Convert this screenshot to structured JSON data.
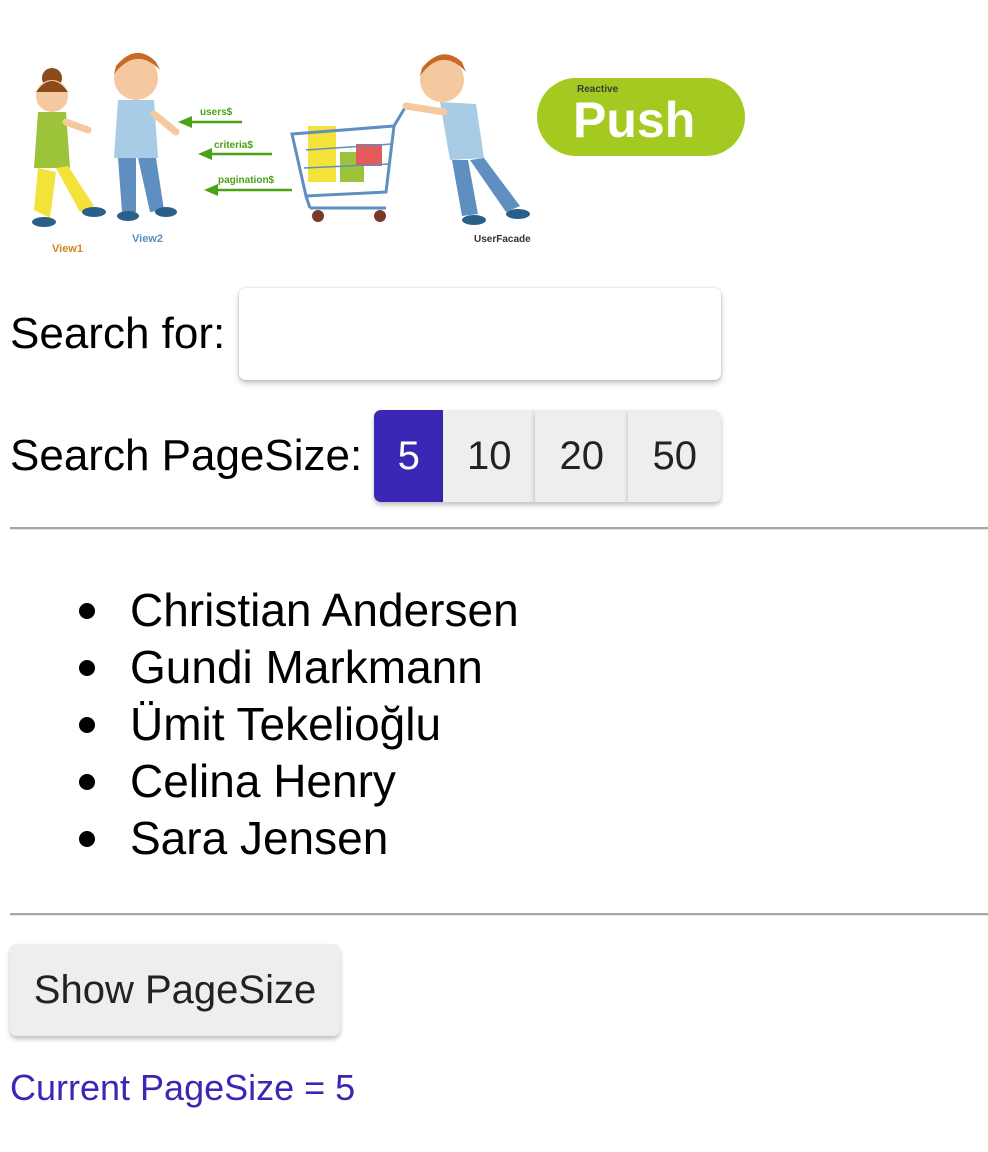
{
  "banner": {
    "arrows": {
      "users": "users$",
      "criteria": "criteria$",
      "pagination": "pagination$"
    },
    "characters": {
      "view1": "View1",
      "view2": "View2",
      "facade": "UserFacade"
    },
    "logo": {
      "small": "Reactive",
      "big": "Push",
      "color": "#a4c920"
    }
  },
  "search": {
    "label": "Search for:",
    "value": "",
    "placeholder": ""
  },
  "pagesize": {
    "label": "Search PageSize:",
    "options": [
      "5",
      "10",
      "20",
      "50"
    ],
    "selected": "5",
    "accent": "#3a27b4"
  },
  "users": [
    "Christian Andersen",
    "Gundi Markmann",
    "Ümit Tekelioğlu",
    "Celina Henry",
    "Sara Jensen"
  ],
  "actions": {
    "show_pagesize_label": "Show PageSize"
  },
  "status": {
    "current_pagesize_text": "Current PageSize = 5"
  }
}
